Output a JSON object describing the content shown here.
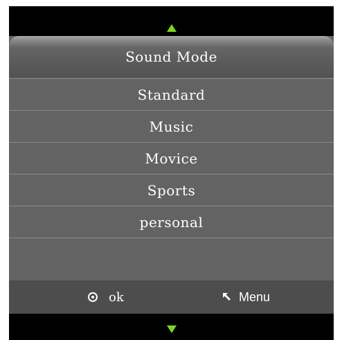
{
  "menu": {
    "title": "Sound Mode",
    "items": [
      {
        "label": "Standard"
      },
      {
        "label": "Music"
      },
      {
        "label": "Movice"
      },
      {
        "label": "Sports"
      },
      {
        "label": "personal"
      }
    ]
  },
  "footer": {
    "ok_label": "ok",
    "ok_icon": "ok-circle-icon",
    "menu_label": "Menu",
    "menu_icon": "return-arrow-icon"
  },
  "colors": {
    "arrow": "#7ed321",
    "panel": "#636363",
    "footer": "#4d4d4d"
  }
}
